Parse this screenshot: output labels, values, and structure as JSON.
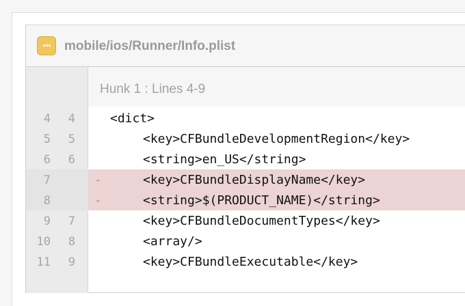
{
  "file": {
    "path": "mobile/ios/Runner/Info.plist",
    "icon": "more-dots-icon",
    "icon_color": "#f0c75e"
  },
  "hunk": {
    "title": "Hunk 1 : Lines 4-9"
  },
  "colors": {
    "deleted_line_bg": "#ecd4d4",
    "deleted_marker": "#d77a7a",
    "gutter_bg": "#ebebeb"
  },
  "lines": [
    {
      "old": "4",
      "new": "4",
      "marker": "",
      "text": "<dict>",
      "type": "context",
      "indent": 0
    },
    {
      "old": "5",
      "new": "5",
      "marker": "",
      "text": "<key>CFBundleDevelopmentRegion</key>",
      "type": "context",
      "indent": 1
    },
    {
      "old": "6",
      "new": "6",
      "marker": "",
      "text": "<string>en_US</string>",
      "type": "context",
      "indent": 1
    },
    {
      "old": "7",
      "new": "",
      "marker": "-",
      "text": "<key>CFBundleDisplayName</key>",
      "type": "deleted",
      "indent": 1
    },
    {
      "old": "8",
      "new": "",
      "marker": "-",
      "text": "<string>$(PRODUCT_NAME)</string>",
      "type": "deleted",
      "indent": 1
    },
    {
      "old": "9",
      "new": "7",
      "marker": "",
      "text": "<key>CFBundleDocumentTypes</key>",
      "type": "context",
      "indent": 1
    },
    {
      "old": "10",
      "new": "8",
      "marker": "",
      "text": "<array/>",
      "type": "context",
      "indent": 1
    },
    {
      "old": "11",
      "new": "9",
      "marker": "",
      "text": "<key>CFBundleExecutable</key>",
      "type": "context",
      "indent": 1
    }
  ]
}
